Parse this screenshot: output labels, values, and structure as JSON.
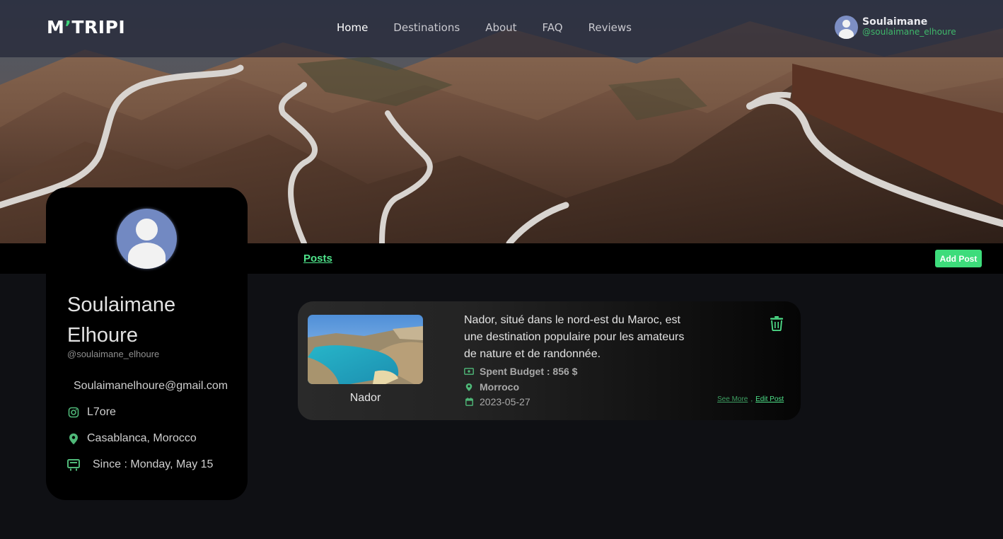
{
  "brand": {
    "logo_prefix": "M",
    "logo_apostrophe": "’",
    "logo_suffix": "TRIPI",
    "accent_color": "#3ddc7b"
  },
  "nav": {
    "links": [
      {
        "label": "Home",
        "active": true
      },
      {
        "label": "Destinations",
        "active": false
      },
      {
        "label": "About",
        "active": false
      },
      {
        "label": "FAQ",
        "active": false
      },
      {
        "label": "Reviews",
        "active": false
      }
    ],
    "user": {
      "name": "Soulaimane",
      "handle": "@soulaimane_elhoure",
      "avatar_icon": "user-avatar-icon"
    }
  },
  "tabs": {
    "posts_label": "Posts",
    "add_post_label": "Add Post"
  },
  "profile": {
    "name": "Soulaimane Elhoure",
    "handle": "@soulaimane_elhoure",
    "email": "Soulaimanelhoure@gmail.com",
    "instagram": "L7ore",
    "location": "Casablanca, Morocco",
    "since": "Since : Monday, May 15",
    "icons": {
      "instagram": "instagram-icon",
      "location": "map-pin-icon",
      "since": "calendar-badge-icon"
    }
  },
  "posts": [
    {
      "title": "Nador",
      "description": "Nador, situé dans le nord-est du Maroc, est une destination populaire pour les amateurs de nature et de randonnée.",
      "budget": "Spent Budget : 856 $",
      "country": "Morroco",
      "date": "2023-05-27",
      "see_more_label": "See More",
      "separator": ",",
      "edit_label": "Edit Post",
      "icons": {
        "budget": "money-icon",
        "country": "map-pin-icon",
        "date": "calendar-icon",
        "delete": "trash-icon"
      }
    }
  ]
}
